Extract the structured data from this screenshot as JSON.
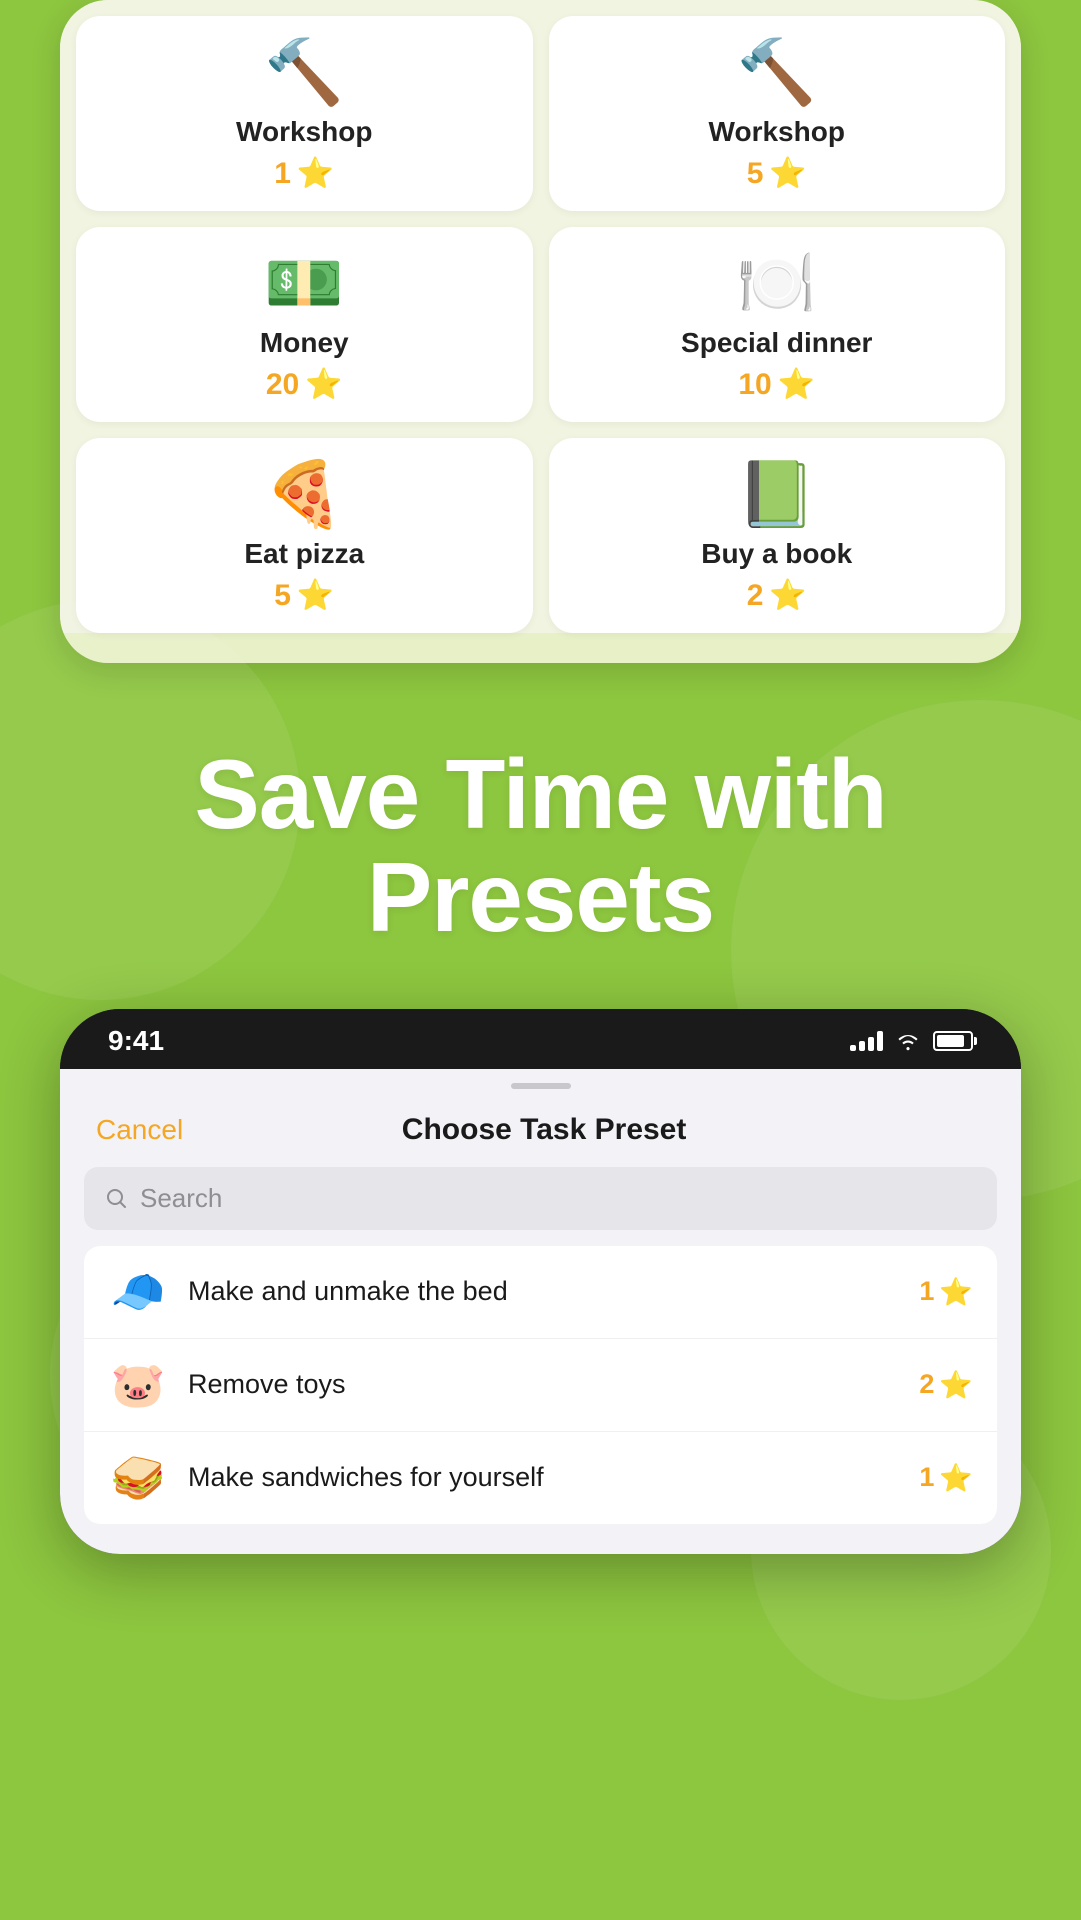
{
  "top_card": {
    "rewards": [
      {
        "id": "workshop1",
        "name": "Workshop",
        "points": "1",
        "icon": "🔨",
        "emoji_label": "workshop-hammer-icon"
      },
      {
        "id": "workshop5",
        "name": "Workshop",
        "points": "5",
        "icon": "🔨",
        "emoji_label": "workshop-hammer-icon-2"
      },
      {
        "id": "money20",
        "name": "Money",
        "points": "20",
        "icon": "💵",
        "emoji_label": "money-icon"
      },
      {
        "id": "special-dinner",
        "name": "Special dinner",
        "points": "10",
        "icon": "🍽️",
        "emoji_label": "special-dinner-icon"
      },
      {
        "id": "eat-pizza",
        "name": "Eat pizza",
        "points": "5",
        "icon": "🍕",
        "emoji_label": "eat-pizza-icon"
      },
      {
        "id": "buy-book",
        "name": "Buy a book",
        "points": "2",
        "icon": "📗",
        "emoji_label": "buy-book-icon"
      }
    ]
  },
  "headline": {
    "line1": "Save Time with",
    "line2": "Presets"
  },
  "phone": {
    "status_bar": {
      "time": "9:41"
    },
    "sheet": {
      "cancel_label": "Cancel",
      "title": "Choose Task Preset",
      "search_placeholder": "Search"
    },
    "tasks": [
      {
        "id": "make-bed",
        "name": "Make and unmake the bed",
        "points": "1",
        "icon": "🧢",
        "emoji_label": "make-bed-icon"
      },
      {
        "id": "remove-toys",
        "name": "Remove toys",
        "points": "2",
        "icon": "🐷",
        "emoji_label": "remove-toys-icon"
      },
      {
        "id": "make-sandwiches",
        "name": "Make sandwiches for yourself",
        "points": "1",
        "icon": "🥪",
        "emoji_label": "make-sandwiches-icon"
      }
    ]
  },
  "colors": {
    "background": "#8dc63f",
    "orange_accent": "#f5a623",
    "white": "#ffffff",
    "card_bg": "#f0f4e0"
  }
}
